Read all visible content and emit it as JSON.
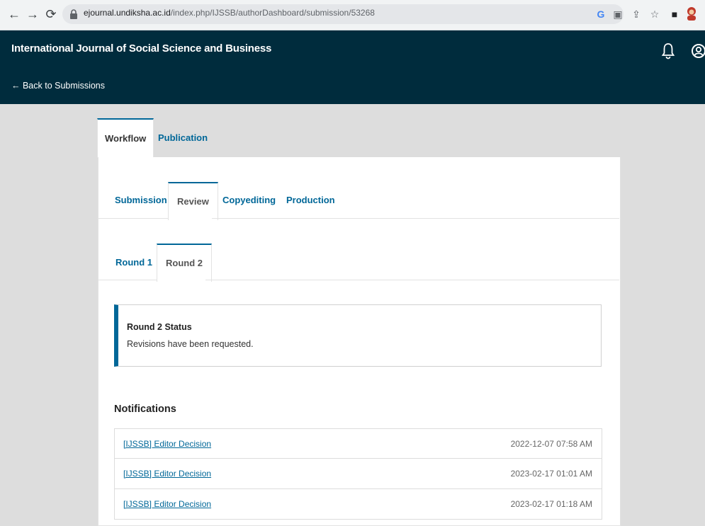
{
  "browser": {
    "url_host": "ejournal.undiksha.ac.id",
    "url_path": "/index.php/IJSSB/authorDashboard/submission/53268"
  },
  "header": {
    "journal_title": "International Journal of Social Science and Business",
    "back_link": "← Back to Submissions"
  },
  "tabs": [
    {
      "label": "Workflow",
      "active": true
    },
    {
      "label": "Publication",
      "active": false
    }
  ],
  "stages": [
    {
      "label": "Submission",
      "active": false
    },
    {
      "label": "Review",
      "active": true
    },
    {
      "label": "Copyediting",
      "active": false
    },
    {
      "label": "Production",
      "active": false
    }
  ],
  "rounds": [
    {
      "label": "Round 1",
      "active": false
    },
    {
      "label": "Round 2",
      "active": true
    }
  ],
  "status": {
    "title": "Round 2 Status",
    "text": "Revisions have been requested."
  },
  "notifications": {
    "heading": "Notifications",
    "items": [
      {
        "title": "[IJSSB] Editor Decision",
        "date": "2022-12-07 07:58 AM"
      },
      {
        "title": "[IJSSB] Editor Decision",
        "date": "2023-02-17 01:01 AM"
      },
      {
        "title": "[IJSSB] Editor Decision",
        "date": "2023-02-17 01:18 AM"
      }
    ]
  },
  "colors": {
    "header_bg": "#002c3d",
    "accent": "#006798"
  }
}
